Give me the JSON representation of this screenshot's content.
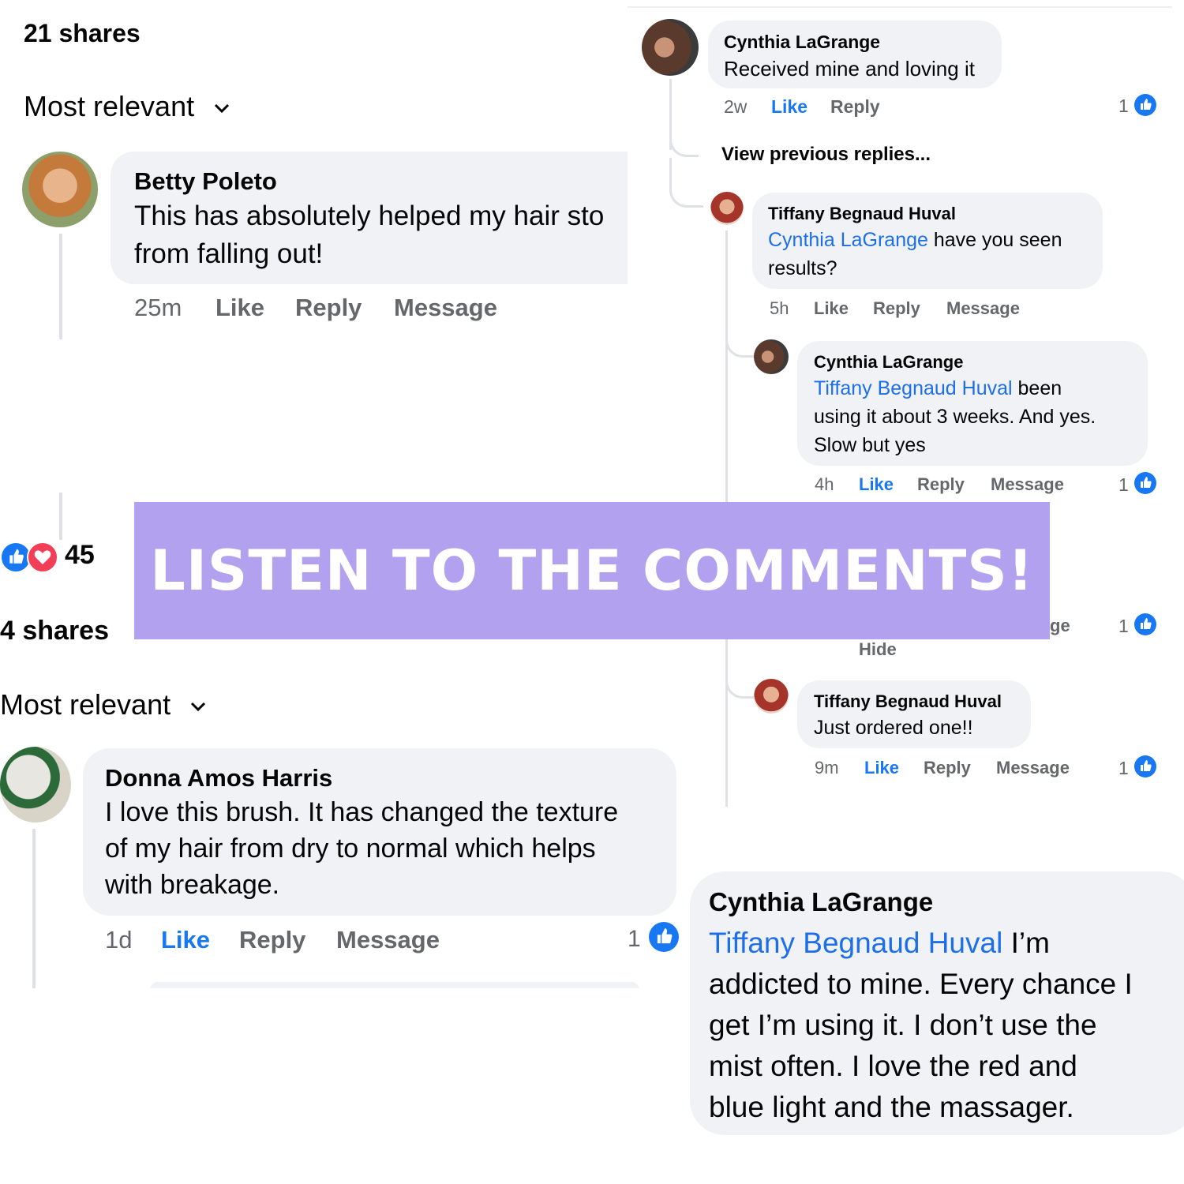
{
  "banner": {
    "text": "LISTEN TO THE COMMENTS!",
    "color": "#b1a1ef"
  },
  "panel_top_left": {
    "shares": "21 shares",
    "sort": "Most relevant",
    "comment": {
      "author": "Betty Poleto",
      "text_line1": "This has absolutely helped my hair sto",
      "text_line2": "from falling out!",
      "time": "25m",
      "like": "Like",
      "reply": "Reply",
      "message": "Message"
    }
  },
  "panel_bottom_left": {
    "reaction_count": "45",
    "shares": "4 shares",
    "sort": "Most relevant",
    "comment": {
      "author": "Donna Amos Harris",
      "text_line1": "I love this brush. It has changed the texture",
      "text_line2": "of my hair from dry to normal which helps",
      "text_line3": "with breakage.",
      "time": "1d",
      "like": "Like",
      "reply": "Reply",
      "message": "Message",
      "like_count": "1"
    }
  },
  "panel_right": {
    "comment1": {
      "author": "Cynthia LaGrange",
      "text": "Received mine and loving it",
      "time": "2w",
      "like": "Like",
      "reply": "Reply",
      "like_count": "1"
    },
    "view_previous": "View previous replies...",
    "reply1": {
      "author": "Tiffany Begnaud Huval",
      "mention": "Cynthia LaGrange",
      "text_rest": " have you seen",
      "text_line2": "results?",
      "time": "5h",
      "like": "Like",
      "reply": "Reply",
      "message": "Message"
    },
    "reply2": {
      "author": "Cynthia LaGrange",
      "mention": "Tiffany Begnaud Huval",
      "text_rest": " been",
      "text_line2": "using it about 3 weeks.  And yes.",
      "text_line3": "Slow but yes",
      "time": "4h",
      "like": "Like",
      "reply": "Reply",
      "message": "Message",
      "like_count": "1"
    },
    "hidden_row": {
      "partial": "ge",
      "hide": "Hide",
      "like_count": "1"
    },
    "reply3": {
      "author": "Tiffany Begnaud Huval",
      "text": "Just ordered one!!",
      "time": "9m",
      "like": "Like",
      "reply": "Reply",
      "message": "Message",
      "like_count": "1"
    }
  },
  "panel_bottom_right": {
    "author": "Cynthia LaGrange",
    "mention": "Tiffany Begnaud Huval",
    "text_rest": " I’m",
    "line2": "addicted to mine.  Every chance I",
    "line3": "get I’m using it.  I don’t use the",
    "line4": "mist often.  I love the red and",
    "line5": "blue light and the massager."
  },
  "colors": {
    "accent": "#1877f2",
    "bubble": "#f0f2f5",
    "meta": "#65676b",
    "love": "#f33e58"
  },
  "icons": [
    "like-icon",
    "love-icon",
    "chevron-down-icon"
  ]
}
